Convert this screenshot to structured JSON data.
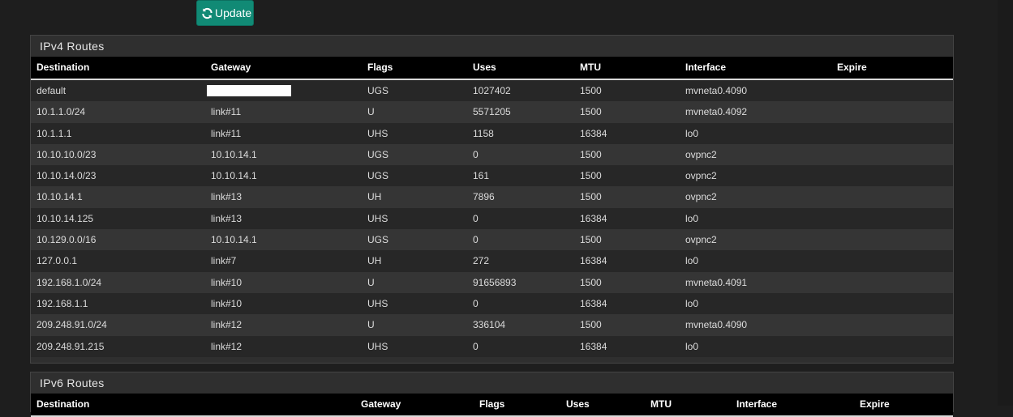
{
  "update_button": {
    "label": "Update",
    "icon": "refresh-icon",
    "color": "#118a75"
  },
  "ipv4": {
    "title": "IPv4 Routes",
    "columns": [
      "Destination",
      "Gateway",
      "Flags",
      "Uses",
      "MTU",
      "Interface",
      "Expire"
    ],
    "rows": [
      [
        "default",
        "",
        "UGS",
        "1027402",
        "1500",
        "mvneta0.4090",
        ""
      ],
      [
        "10.1.1.0/24",
        "link#11",
        "U",
        "5571205",
        "1500",
        "mvneta0.4092",
        ""
      ],
      [
        "10.1.1.1",
        "link#11",
        "UHS",
        "1158",
        "16384",
        "lo0",
        ""
      ],
      [
        "10.10.10.0/23",
        "10.10.14.1",
        "UGS",
        "0",
        "1500",
        "ovpnc2",
        ""
      ],
      [
        "10.10.14.0/23",
        "10.10.14.1",
        "UGS",
        "161",
        "1500",
        "ovpnc2",
        ""
      ],
      [
        "10.10.14.1",
        "link#13",
        "UH",
        "7896",
        "1500",
        "ovpnc2",
        ""
      ],
      [
        "10.10.14.125",
        "link#13",
        "UHS",
        "0",
        "16384",
        "lo0",
        ""
      ],
      [
        "10.129.0.0/16",
        "10.10.14.1",
        "UGS",
        "0",
        "1500",
        "ovpnc2",
        ""
      ],
      [
        "127.0.0.1",
        "link#7",
        "UH",
        "272",
        "16384",
        "lo0",
        ""
      ],
      [
        "192.168.1.0/24",
        "link#10",
        "U",
        "91656893",
        "1500",
        "mvneta0.4091",
        ""
      ],
      [
        "192.168.1.1",
        "link#10",
        "UHS",
        "0",
        "16384",
        "lo0",
        ""
      ],
      [
        "209.248.91.0/24",
        "link#12",
        "U",
        "336104",
        "1500",
        "mvneta0.4090",
        ""
      ],
      [
        "209.248.91.215",
        "link#12",
        "UHS",
        "0",
        "16384",
        "lo0",
        ""
      ]
    ]
  },
  "ipv6": {
    "title": "IPv6 Routes",
    "columns": [
      "Destination",
      "Gateway",
      "Flags",
      "Uses",
      "MTU",
      "Interface",
      "Expire"
    ]
  }
}
